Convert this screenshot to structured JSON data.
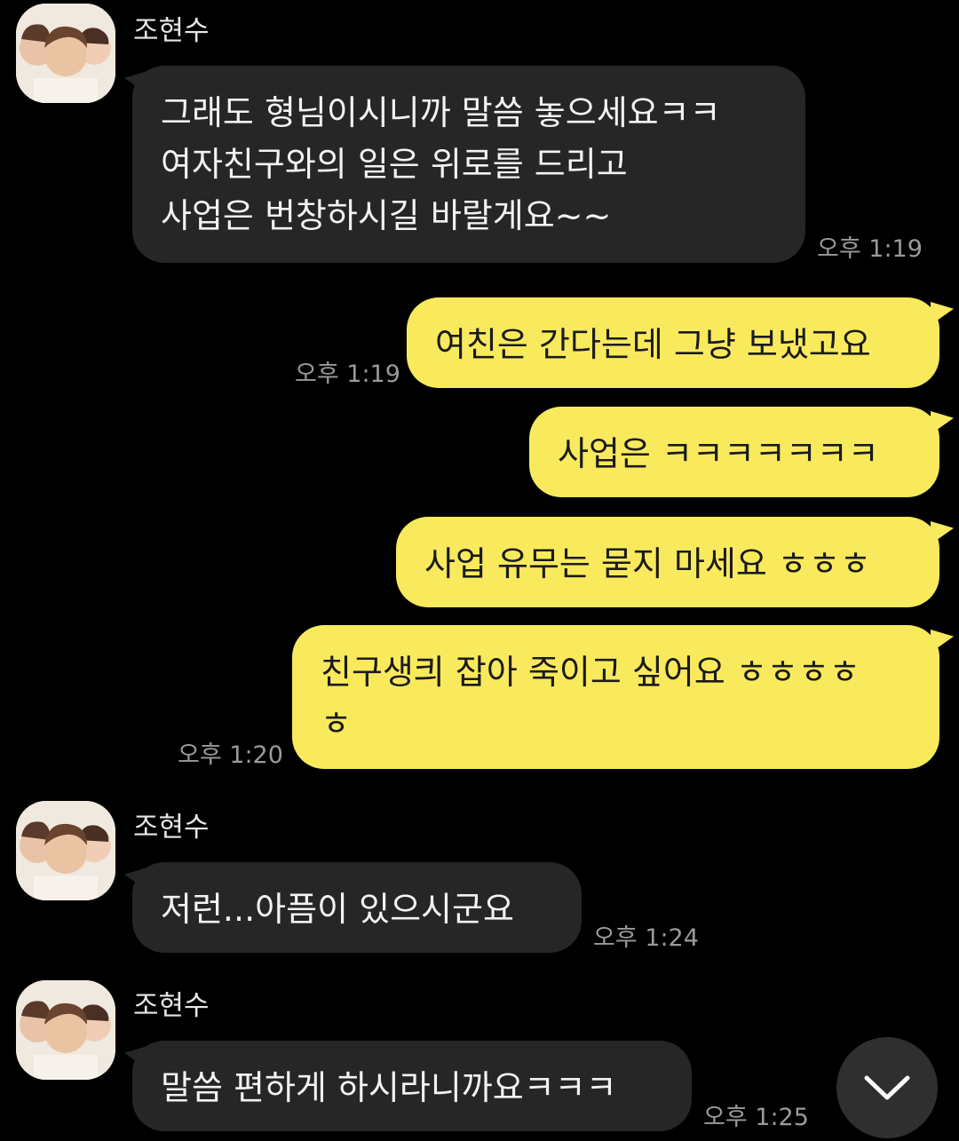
{
  "messages": [
    {
      "id": "m1",
      "direction": "in",
      "sender": "조현수",
      "text": "그래도 형님이시니까 말씀 놓으세요ㅋㅋ\n여자친구와의 일은 위로를 드리고\n사업은 번창하시길 바랄게요~~",
      "time": "오후 1:19"
    },
    {
      "id": "m2",
      "direction": "out",
      "text": "여친은 간다는데 그냥 보냈고요",
      "time": "오후 1:19"
    },
    {
      "id": "m3",
      "direction": "out",
      "text": "사업은 ㅋㅋㅋㅋㅋㅋㅋ",
      "time": ""
    },
    {
      "id": "m4",
      "direction": "out",
      "text": "사업 유무는 묻지 마세요 ㅎㅎㅎ",
      "time": ""
    },
    {
      "id": "m5",
      "direction": "out",
      "text": "친구생킈 잡아 죽이고 싶어요 ㅎㅎㅎㅎ\nㅎ",
      "time": "오후 1:20"
    },
    {
      "id": "m6",
      "direction": "in",
      "sender": "조현수",
      "text": "저런...아픔이 있으시군요",
      "time": "오후 1:24"
    },
    {
      "id": "m7",
      "direction": "in",
      "sender": "조현수",
      "text": "말씀 편하게 하시라니까요ㅋㅋㅋ",
      "time": "오후 1:25"
    }
  ],
  "scroll_button": {
    "icon": "chevron-down-icon"
  },
  "avatar": {
    "icon": "profile-photo"
  }
}
